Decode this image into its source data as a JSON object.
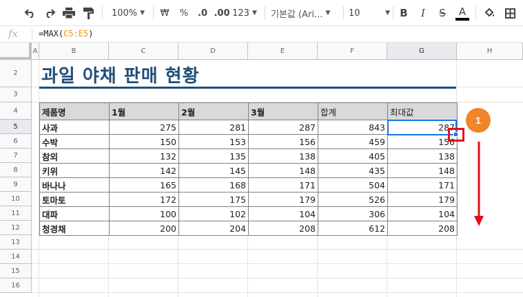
{
  "toolbar": {
    "zoom": "100%",
    "currency": "₩",
    "percent": "%",
    "dec_decrease": ".0",
    "dec_increase": ".00",
    "number_format": "123",
    "font_name": "기본값 (Ari...",
    "font_size": "10",
    "bold": "B",
    "italic": "I",
    "strike": "S",
    "text_color": "A"
  },
  "formula_bar": {
    "fx": "fx",
    "prefix": "=MAX(",
    "range": "C5:E5",
    "suffix": ")"
  },
  "columns": [
    "A",
    "B",
    "C",
    "D",
    "E",
    "F",
    "G",
    "H"
  ],
  "rows": [
    "2",
    "3",
    "4",
    "5",
    "6",
    "7",
    "8",
    "9",
    "10",
    "11",
    "12",
    "13",
    "14",
    "15",
    "16"
  ],
  "sheet": {
    "title": "과일 야채 판매 현황",
    "headers": [
      "제품명",
      "1월",
      "2월",
      "3월",
      "합계",
      "최대값"
    ],
    "items": [
      {
        "name": "사과",
        "m1": "275",
        "m2": "281",
        "m3": "287",
        "sum": "843",
        "max": "287"
      },
      {
        "name": "수박",
        "m1": "150",
        "m2": "153",
        "m3": "156",
        "sum": "459",
        "max": "156"
      },
      {
        "name": "참외",
        "m1": "132",
        "m2": "135",
        "m3": "138",
        "sum": "405",
        "max": "138"
      },
      {
        "name": "키위",
        "m1": "142",
        "m2": "145",
        "m3": "148",
        "sum": "435",
        "max": "148"
      },
      {
        "name": "바나나",
        "m1": "165",
        "m2": "168",
        "m3": "171",
        "sum": "504",
        "max": "171"
      },
      {
        "name": "토마토",
        "m1": "172",
        "m2": "175",
        "m3": "179",
        "sum": "526",
        "max": "179"
      },
      {
        "name": "대파",
        "m1": "100",
        "m2": "102",
        "m3": "104",
        "sum": "306",
        "max": "104"
      },
      {
        "name": "청경채",
        "m1": "200",
        "m2": "204",
        "m3": "208",
        "sum": "612",
        "max": "208"
      }
    ]
  },
  "annotation": {
    "step": "1"
  },
  "colors": {
    "title": "#1f4e79",
    "selection": "#1a73e8",
    "annotation_box": "#e0101a",
    "badge": "#f0852a"
  }
}
